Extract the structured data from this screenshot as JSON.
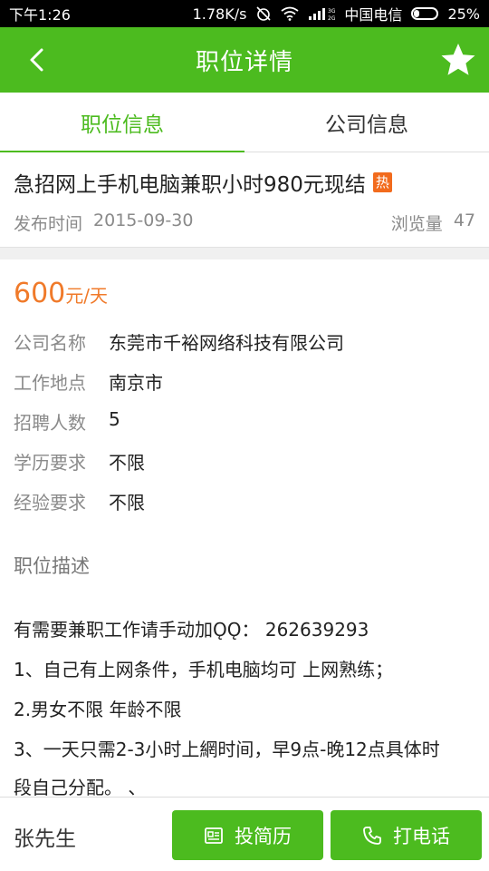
{
  "status_bar": {
    "time": "下午1:26",
    "speed": "1.78K/s",
    "carrier": "中国电信",
    "battery": "25%",
    "battery_level": 0.25
  },
  "app_bar": {
    "title": "职位详情",
    "back_icon": "chevron-left-icon",
    "favorite_icon": "star-icon"
  },
  "tabs": [
    {
      "label": "职位信息",
      "active": true
    },
    {
      "label": "公司信息",
      "active": false
    }
  ],
  "job": {
    "title": "急招网上手机电脑兼职小时980元现结",
    "hot_badge": "热",
    "publish_label": "发布时间",
    "publish_date": "2015-09-30",
    "views_label": "浏览量",
    "views": "47",
    "salary_amount": "600",
    "salary_unit": "元/天",
    "fields": [
      {
        "label": "公司名称",
        "value": "东莞市千裕网络科技有限公司"
      },
      {
        "label": "工作地点",
        "value": "南京市"
      },
      {
        "label": "招聘人数",
        "value": "5"
      },
      {
        "label": "学历要求",
        "value": "不限"
      },
      {
        "label": "经验要求",
        "value": "不限"
      }
    ],
    "description_title": "职位描述",
    "description_lines": [
      "有需要兼职工作请手动加ǪǪ： 262639293",
      "1、自己有上网条件，手机电脑均可 上网熟练；",
      "2.男女不限 年龄不限",
      "3、一天只需2-3小时上網时间，早9点-晚12点具体时",
      "段自己分配。 、"
    ]
  },
  "bottom_bar": {
    "contact_name": "张先生",
    "resume_button": "投简历",
    "call_button": "打电话"
  },
  "colors": {
    "brand_green": "#4cbb1f",
    "salary_orange": "#f07a2a",
    "hot_badge": "#f26b1d"
  }
}
